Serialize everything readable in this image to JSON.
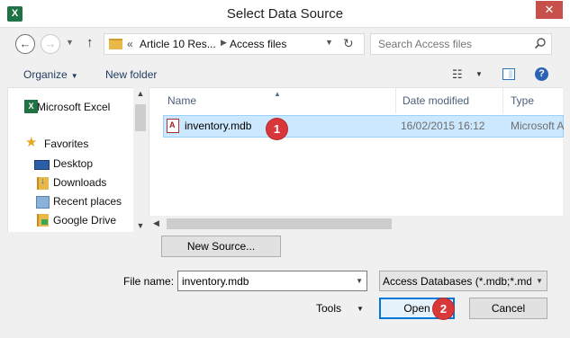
{
  "window": {
    "title": "Select Data Source",
    "app_icon": "X",
    "close_glyph": "✕"
  },
  "nav": {
    "back_glyph": "←",
    "forward_glyph": "→",
    "history_glyph": "▼",
    "up_glyph": "↑"
  },
  "address": {
    "chevron": "«",
    "segments": [
      "Article 10 Res...",
      "Access files"
    ],
    "separator": "▶",
    "dropdown_glyph": "▼",
    "refresh_glyph": "↻"
  },
  "search": {
    "placeholder": "Search Access files"
  },
  "toolbar": {
    "organize": "Organize",
    "dropdown_glyph": "▼",
    "new_folder": "New folder",
    "view_glyph": "☷"
  },
  "navigation_pane": {
    "top_item": "Microsoft Excel",
    "favorites_label": "Favorites",
    "favorites": [
      "Desktop",
      "Downloads",
      "Recent places",
      "Google Drive"
    ],
    "scroll_up": "▲",
    "scroll_down": "▼"
  },
  "file_list": {
    "columns": [
      "Name",
      "Date modified",
      "Type"
    ],
    "sort_glyph": "▲",
    "files": [
      {
        "name": "inventory.mdb",
        "date_modified": "16/02/2015 16:12",
        "type": "Microsoft A",
        "selected": true
      }
    ],
    "scroll_left": "◀"
  },
  "buttons": {
    "new_source": "New Source...",
    "tools": "Tools",
    "open": "Open",
    "cancel": "Cancel"
  },
  "filename": {
    "label": "File name:",
    "value": "inventory.mdb"
  },
  "filetype": {
    "selected": "Access Databases (*.mdb;*.mdc"
  },
  "annotations": {
    "step1": "1",
    "step2": "2"
  },
  "colors": {
    "selection_bg": "#cce8ff",
    "badge": "#d9383b",
    "excel_green": "#1f7244",
    "close_red": "#c7504b"
  }
}
